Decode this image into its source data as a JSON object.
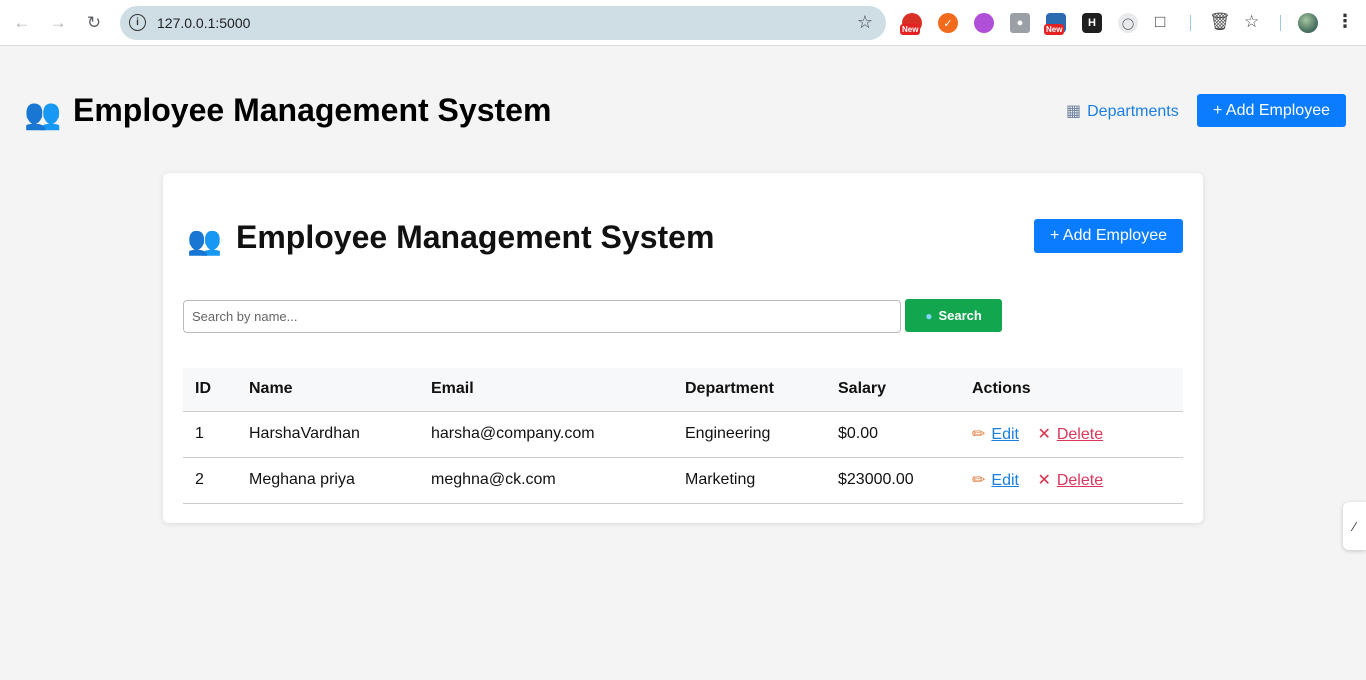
{
  "browser": {
    "url": "127.0.0.1:5000",
    "extension_badge": "New"
  },
  "header": {
    "icon": "people-icon",
    "title": "Employee Management System",
    "departments_label": "Departments",
    "add_employee_label": "+ Add Employee"
  },
  "card": {
    "title": "Employee Management System",
    "add_employee_label": "+ Add Employee",
    "search_placeholder": "Search by name...",
    "search_value": "",
    "search_button_label": "Search",
    "columns": [
      "ID",
      "Name",
      "Email",
      "Department",
      "Salary",
      "Actions"
    ],
    "rows": [
      {
        "id": "1",
        "name": "HarshaVardhan",
        "email": "harsha@company.com",
        "department": "Engineering",
        "salary": "$0.00",
        "edit": "Edit",
        "delete": "Delete"
      },
      {
        "id": "2",
        "name": "Meghana priya",
        "email": "meghna@ck.com",
        "department": "Marketing",
        "salary": "$23000.00",
        "edit": "Edit",
        "delete": "Delete"
      }
    ]
  },
  "colors": {
    "primary": "#0a7cff",
    "search_green": "#12a64f",
    "link_blue": "#1a7fe0",
    "delete_red": "#d9365a"
  }
}
